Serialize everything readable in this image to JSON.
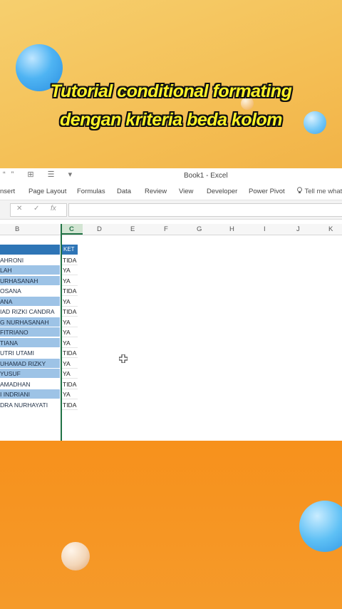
{
  "overlay": {
    "title_line1": "Tutorial conditional formating",
    "title_line2": "dengan kriteria beda kolom"
  },
  "window": {
    "title": "Book1 - Excel",
    "quick_access_icons": "“” ⊞ ☰ ▾"
  },
  "ribbon": {
    "tabs": [
      "nsert",
      "Page Layout",
      "Formulas",
      "Data",
      "Review",
      "View",
      "Developer",
      "Power Pivot"
    ],
    "tell_me": "Tell me what"
  },
  "formula_bar": {
    "cancel": "✕",
    "enter": "✓",
    "fx": "fx",
    "value": ""
  },
  "columns": [
    "B",
    "C",
    "D",
    "E",
    "F",
    "G",
    "H",
    "I",
    "J",
    "K"
  ],
  "table": {
    "header_ket": "KET",
    "rows": [
      {
        "name": "AHRONI",
        "ket": "TIDA",
        "highlight": false
      },
      {
        "name": "LAH",
        "ket": "YA",
        "highlight": true
      },
      {
        "name": "URHASANAH",
        "ket": "YA",
        "highlight": true
      },
      {
        "name": "OSANA",
        "ket": "TIDA",
        "highlight": false
      },
      {
        "name": "ANA",
        "ket": "YA",
        "highlight": true
      },
      {
        "name": "IAD RIZKI CANDRA",
        "ket": "TIDA",
        "highlight": false
      },
      {
        "name": "G NURHASANAH",
        "ket": "YA",
        "highlight": true
      },
      {
        "name": "FITRIANO",
        "ket": "YA",
        "highlight": true
      },
      {
        "name": "TIANA",
        "ket": "YA",
        "highlight": true
      },
      {
        "name": "UTRI UTAMI",
        "ket": "TIDA",
        "highlight": false
      },
      {
        "name": "UHAMAD RIZKY",
        "ket": "YA",
        "highlight": true
      },
      {
        "name": "YUSUF",
        "ket": "YA",
        "highlight": true
      },
      {
        "name": "AMADHAN",
        "ket": "TIDA",
        "highlight": false
      },
      {
        "name": "I INDRIANI",
        "ket": "YA",
        "highlight": true
      },
      {
        "name": "DRA NURHAYATI",
        "ket": "TIDA",
        "highlight": false
      }
    ]
  }
}
